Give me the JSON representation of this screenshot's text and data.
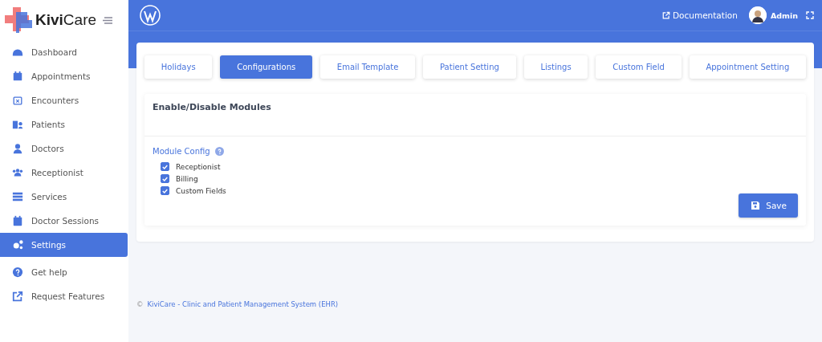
{
  "sidebar": {
    "logo": {
      "bold": "Kivi",
      "rest": "Care"
    },
    "items": [
      {
        "label": "Dashboard",
        "selected": false
      },
      {
        "label": "Appointments",
        "selected": false
      },
      {
        "label": "Encounters",
        "selected": false
      },
      {
        "label": "Patients",
        "selected": false
      },
      {
        "label": "Doctors",
        "selected": false
      },
      {
        "label": "Receptionist",
        "selected": false
      },
      {
        "label": "Services",
        "selected": false
      },
      {
        "label": "Doctor Sessions",
        "selected": false
      },
      {
        "label": "Settings",
        "selected": true
      },
      {
        "label": "Get help",
        "selected": false
      },
      {
        "label": "Request Features",
        "selected": false
      }
    ]
  },
  "topbar": {
    "documentation": "Documentation",
    "user": "Admin"
  },
  "tabs": [
    {
      "label": "Holidays",
      "selected": false
    },
    {
      "label": "Configurations",
      "selected": true
    },
    {
      "label": "Email Template",
      "selected": false
    },
    {
      "label": "Patient Setting",
      "selected": false
    },
    {
      "label": "Listings",
      "selected": false
    },
    {
      "label": "Custom Field",
      "selected": false
    },
    {
      "label": "Appointment Setting",
      "selected": false
    }
  ],
  "panel": {
    "title": "Enable/Disable Modules",
    "section": "Module Config",
    "modules": [
      {
        "label": "Receptionist",
        "checked": true
      },
      {
        "label": "Billing",
        "checked": true
      },
      {
        "label": "Custom Fields",
        "checked": true
      }
    ],
    "save": "Save"
  },
  "footer": {
    "copyright": "©",
    "link": "KiviCare - Clinic and Patient Management System (EHR)"
  }
}
